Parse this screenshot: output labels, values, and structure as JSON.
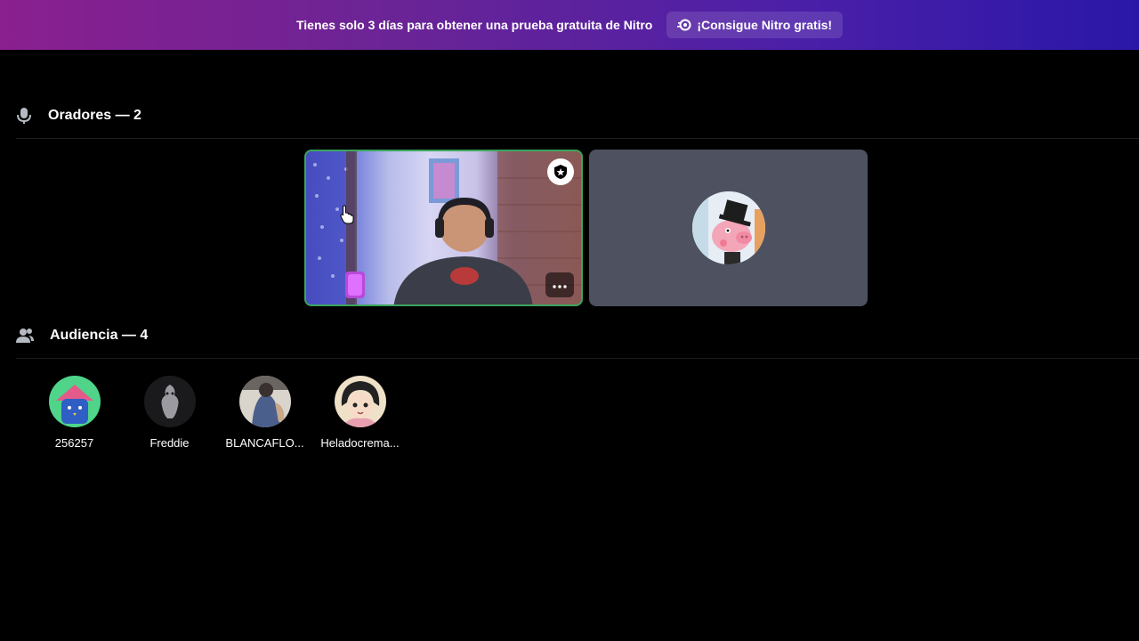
{
  "banner": {
    "text": "Tienes solo 3 días para obtener una prueba gratuita de Nitro",
    "button_label": "¡Consigue Nitro gratis!"
  },
  "speakers": {
    "header": "Oradores — 2",
    "icon": "microphone-icon"
  },
  "audience": {
    "header": "Audiencia — 4",
    "icon": "people-icon",
    "members": [
      {
        "name": "256257"
      },
      {
        "name": "Freddie"
      },
      {
        "name": "BLANCAFLO..."
      },
      {
        "name": "Heladocrema..."
      }
    ]
  },
  "colors": {
    "speaking_border": "#3ba55d",
    "tile_bg": "#4e5160",
    "background": "#000000"
  }
}
